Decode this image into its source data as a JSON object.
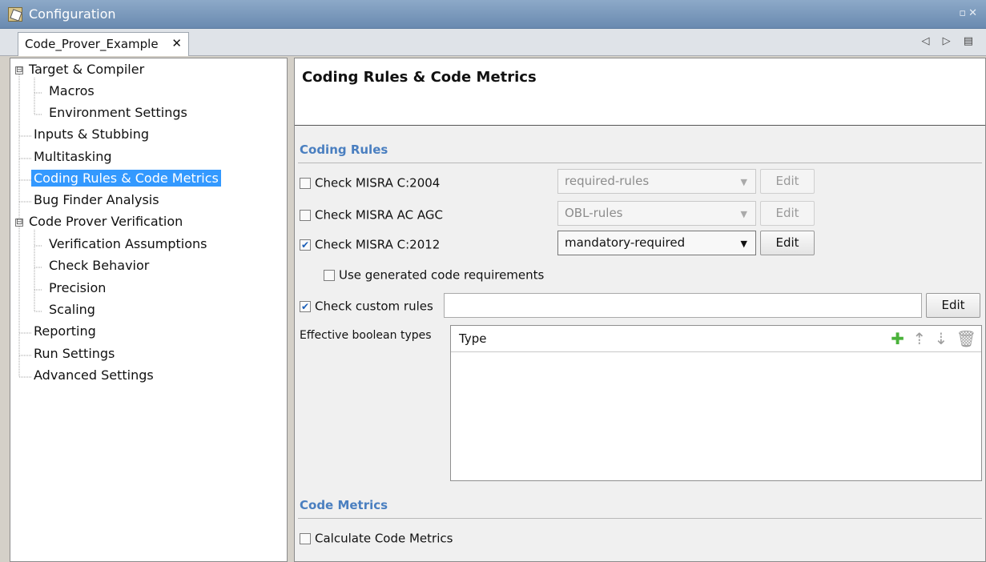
{
  "window": {
    "title": "Configuration"
  },
  "tabs": [
    {
      "label": "Code_Prover_Example"
    }
  ],
  "tree": [
    {
      "label": "Target & Compiler",
      "expander": "⊟"
    },
    {
      "label": "Macros"
    },
    {
      "label": "Environment Settings"
    },
    {
      "label": "Inputs & Stubbing"
    },
    {
      "label": "Multitasking"
    },
    {
      "label": "Coding Rules & Code Metrics",
      "selected": true
    },
    {
      "label": "Bug Finder Analysis"
    },
    {
      "label": "Code Prover Verification",
      "expander": "⊟"
    },
    {
      "label": "Verification Assumptions"
    },
    {
      "label": "Check Behavior"
    },
    {
      "label": "Precision"
    },
    {
      "label": "Scaling"
    },
    {
      "label": "Reporting"
    },
    {
      "label": "Run Settings"
    },
    {
      "label": "Advanced Settings"
    }
  ],
  "page": {
    "title": "Coding Rules & Code Metrics",
    "coding_rules": {
      "header": "Coding Rules",
      "misra_2004": {
        "label": "Check MISRA C:2004",
        "checked": false,
        "combo": "required-rules",
        "edit": "Edit"
      },
      "misra_agc": {
        "label": "Check MISRA AC AGC",
        "checked": false,
        "combo": "OBL-rules",
        "edit": "Edit"
      },
      "misra_2012": {
        "label": "Check MISRA C:2012",
        "checked": true,
        "combo": "mandatory-required",
        "edit": "Edit"
      },
      "use_generated": {
        "label": "Use generated code requirements",
        "checked": false
      },
      "custom_rules": {
        "label": "Check custom rules",
        "checked": true,
        "value": "",
        "edit": "Edit"
      },
      "boolean_types": {
        "label": "Effective boolean types",
        "column_header": "Type"
      }
    },
    "code_metrics": {
      "header": "Code Metrics",
      "calculate": {
        "label": "Calculate Code Metrics",
        "checked": false
      }
    }
  },
  "glyphs": {
    "checked": "✔",
    "combo_arrow": "▼",
    "close": "✕",
    "window_controls": "▫✕",
    "tab_nav": "◁ ▷ ▤",
    "add": "✚",
    "move_up": "⇡",
    "move_down": "⇣",
    "delete": "🗑"
  }
}
